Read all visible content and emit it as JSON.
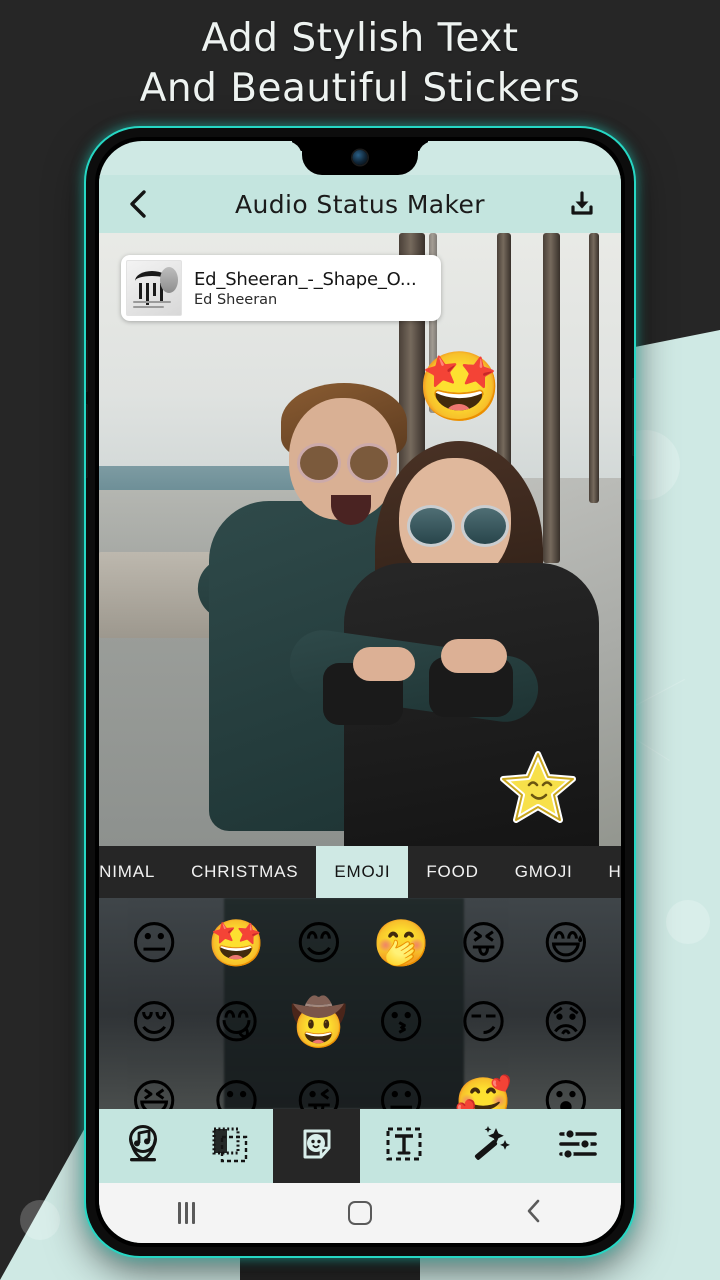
{
  "promo": {
    "headline_line1": "Add Stylish Text",
    "headline_line2": "And Beautiful Stickers",
    "background_dark": "#262626",
    "background_mint": "#cfe9e4",
    "phone_glow": "#26d7c4"
  },
  "app": {
    "header": {
      "back_icon": "chevron-left-icon",
      "title": "Audio Status Maker",
      "download_icon": "download-icon",
      "background": "#c4e5df"
    },
    "song_card": {
      "title": "Ed_Sheeran_-_Shape_O...",
      "artist": "Ed Sheeran",
      "album_art": "album-art-thumbnail"
    },
    "stickers": [
      {
        "name": "star-struck-emoji-sticker",
        "glyph": "🤩"
      },
      {
        "name": "smiling-star-sticker",
        "glyph": "star"
      }
    ],
    "tabs": [
      {
        "label": "ANIMAL",
        "active": false
      },
      {
        "label": "CHRISTMAS",
        "active": false
      },
      {
        "label": "EMOJI",
        "active": true
      },
      {
        "label": "FOOD",
        "active": false
      },
      {
        "label": "GMOJI",
        "active": false
      },
      {
        "label": "H",
        "active": false
      }
    ],
    "emoji_grid": {
      "rows": [
        [
          "😐",
          "🤩",
          "😊",
          "🤭",
          "😝",
          "😅"
        ],
        [
          "😌",
          "😋",
          "🤠",
          "😗",
          "😏",
          "😟"
        ],
        [
          "😆",
          "😶",
          "😜",
          "😐",
          "🥰",
          "😮"
        ]
      ]
    },
    "toolbar": [
      {
        "name": "audio-tool",
        "icon": "music-pin-icon",
        "active": false
      },
      {
        "name": "frame-tool",
        "icon": "frame-layers-icon",
        "active": false
      },
      {
        "name": "sticker-tool",
        "icon": "sticker-face-icon",
        "active": true
      },
      {
        "name": "text-tool",
        "icon": "text-box-icon",
        "active": false
      },
      {
        "name": "effects-tool",
        "icon": "magic-wand-icon",
        "active": false
      },
      {
        "name": "adjust-tool",
        "icon": "sliders-icon",
        "active": false
      }
    ],
    "navbar": [
      {
        "name": "recents-button",
        "icon": "recents-icon"
      },
      {
        "name": "home-button",
        "icon": "home-icon"
      },
      {
        "name": "back-button",
        "icon": "back-chevron-icon"
      }
    ]
  }
}
